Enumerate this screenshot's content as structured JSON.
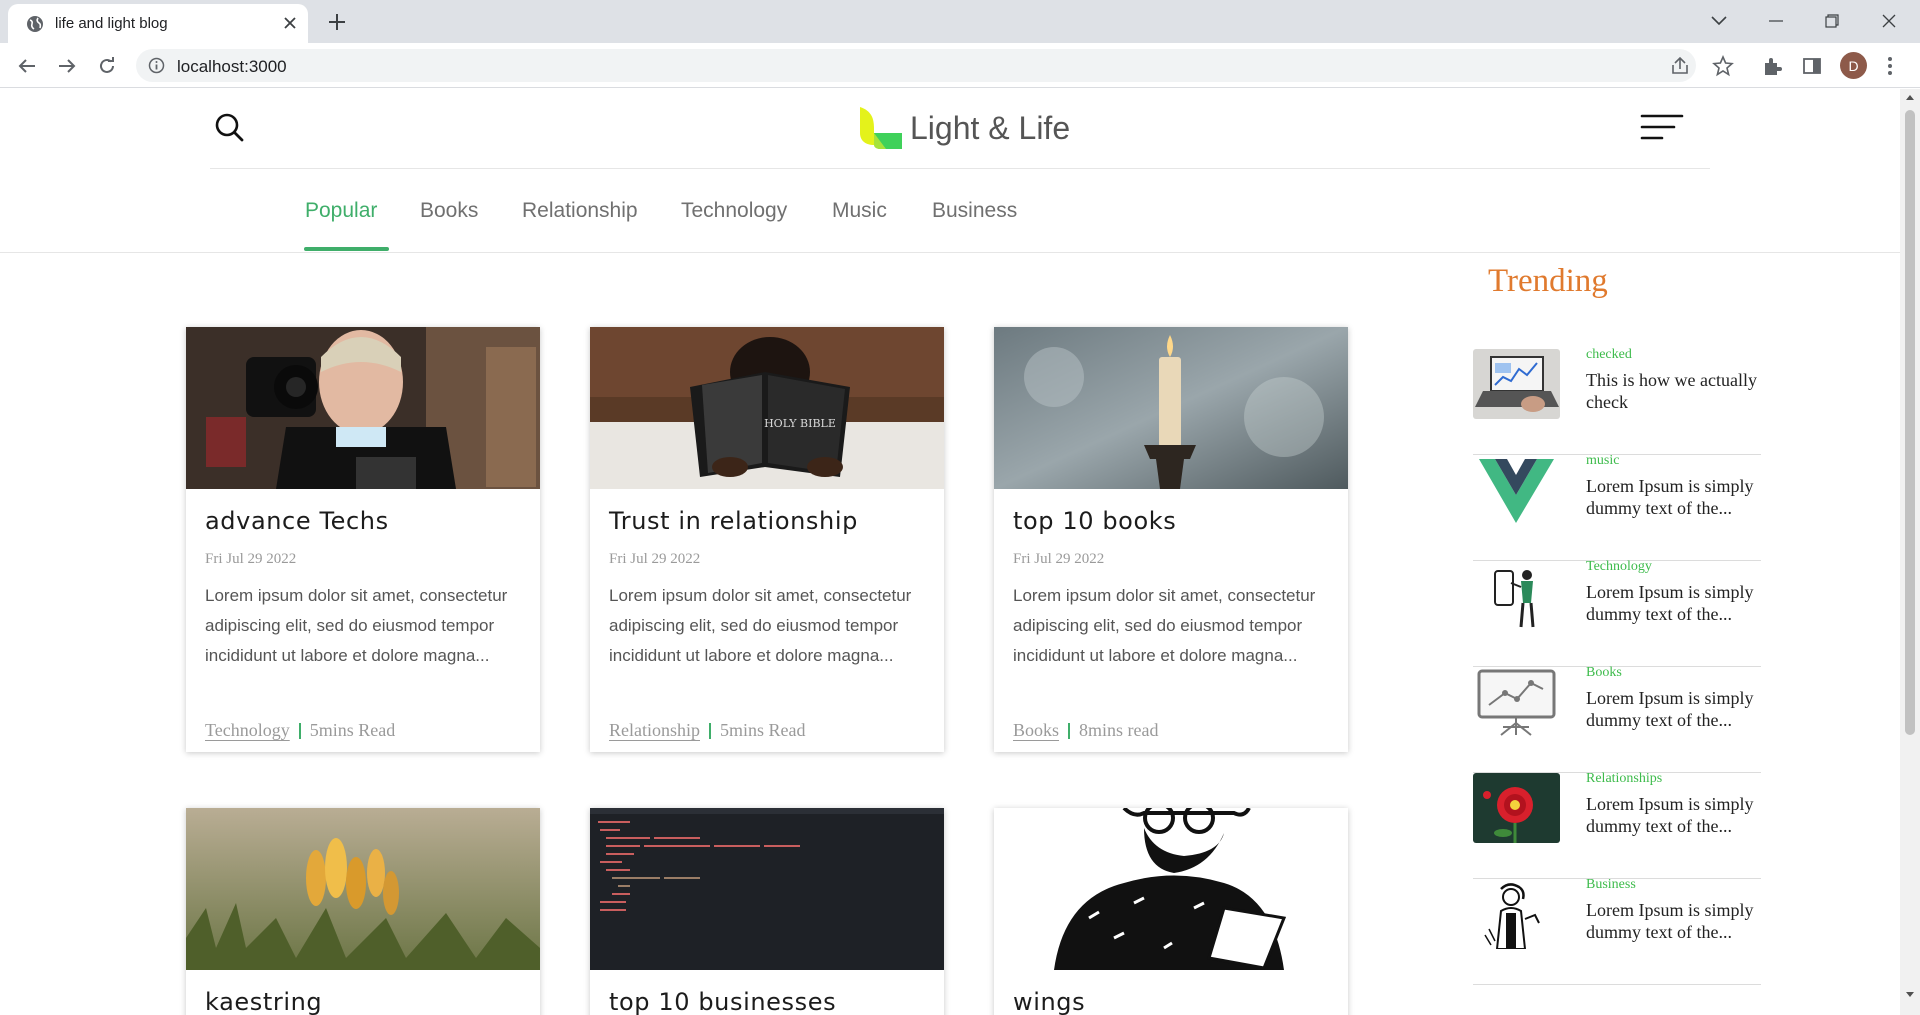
{
  "browser": {
    "tab_title": "life and light blog",
    "url": "localhost:3000",
    "avatar_letter": "D"
  },
  "site": {
    "brand_name": "Light & Life",
    "accent_color": "#3fae6a",
    "trending_color": "#e07a2e"
  },
  "nav": {
    "items": [
      {
        "label": "Popular",
        "active": true
      },
      {
        "label": "Books"
      },
      {
        "label": "Relationship"
      },
      {
        "label": "Technology"
      },
      {
        "label": "Music"
      },
      {
        "label": "Business"
      }
    ]
  },
  "posts": [
    {
      "title": "advance Techs",
      "date": "Fri Jul 29 2022",
      "excerpt": "Lorem ipsum dolor sit amet, consectetur adipiscing elit, sed do eiusmod tempor incididunt ut labore et dolore magna...",
      "category": "Technology",
      "read_time": "5mins Read",
      "image": "man-with-camera-photo"
    },
    {
      "title": "Trust in relationship",
      "date": "Fri Jul 29 2022",
      "excerpt": "Lorem ipsum dolor sit amet, consectetur adipiscing elit, sed do eiusmod tempor incididunt ut labore et dolore magna...",
      "category": "Relationship",
      "read_time": "5mins Read",
      "image": "child-reading-holy-bible-photo",
      "image_text": "HOLY BIBLE"
    },
    {
      "title": "top 10 books",
      "date": "Fri Jul 29 2022",
      "excerpt": "Lorem ipsum dolor sit amet, consectetur adipiscing elit, sed do eiusmod tempor incididunt ut labore et dolore magna...",
      "category": "Books",
      "read_time": "8mins read",
      "image": "candle-photo"
    },
    {
      "title": "kaestring",
      "image": "crocus-flowers-photo"
    },
    {
      "title": "top 10 businesses",
      "image": "code-editor-screenshot"
    },
    {
      "title": "wings",
      "image": "bearded-man-illustration"
    }
  ],
  "trending": {
    "heading": "Trending",
    "items": [
      {
        "category": "checked",
        "text": "This is how we actually check",
        "thumb": "laptop-analytics-photo"
      },
      {
        "category": "music",
        "text": "Lorem Ipsum is simply dummy text of the...",
        "thumb": "vue-logo"
      },
      {
        "category": "Technology",
        "text": "Lorem Ipsum is simply dummy text of the...",
        "thumb": "person-with-phone-illustration"
      },
      {
        "category": "Books",
        "text": "Lorem Ipsum is simply dummy text of the...",
        "thumb": "presentation-board-icon"
      },
      {
        "category": "Relationships",
        "text": "Lorem Ipsum is simply dummy text of the...",
        "thumb": "red-flower-photo"
      },
      {
        "category": "Business",
        "text": "Lorem Ipsum is simply dummy text of the...",
        "thumb": "person-sketch-illustration"
      }
    ]
  }
}
